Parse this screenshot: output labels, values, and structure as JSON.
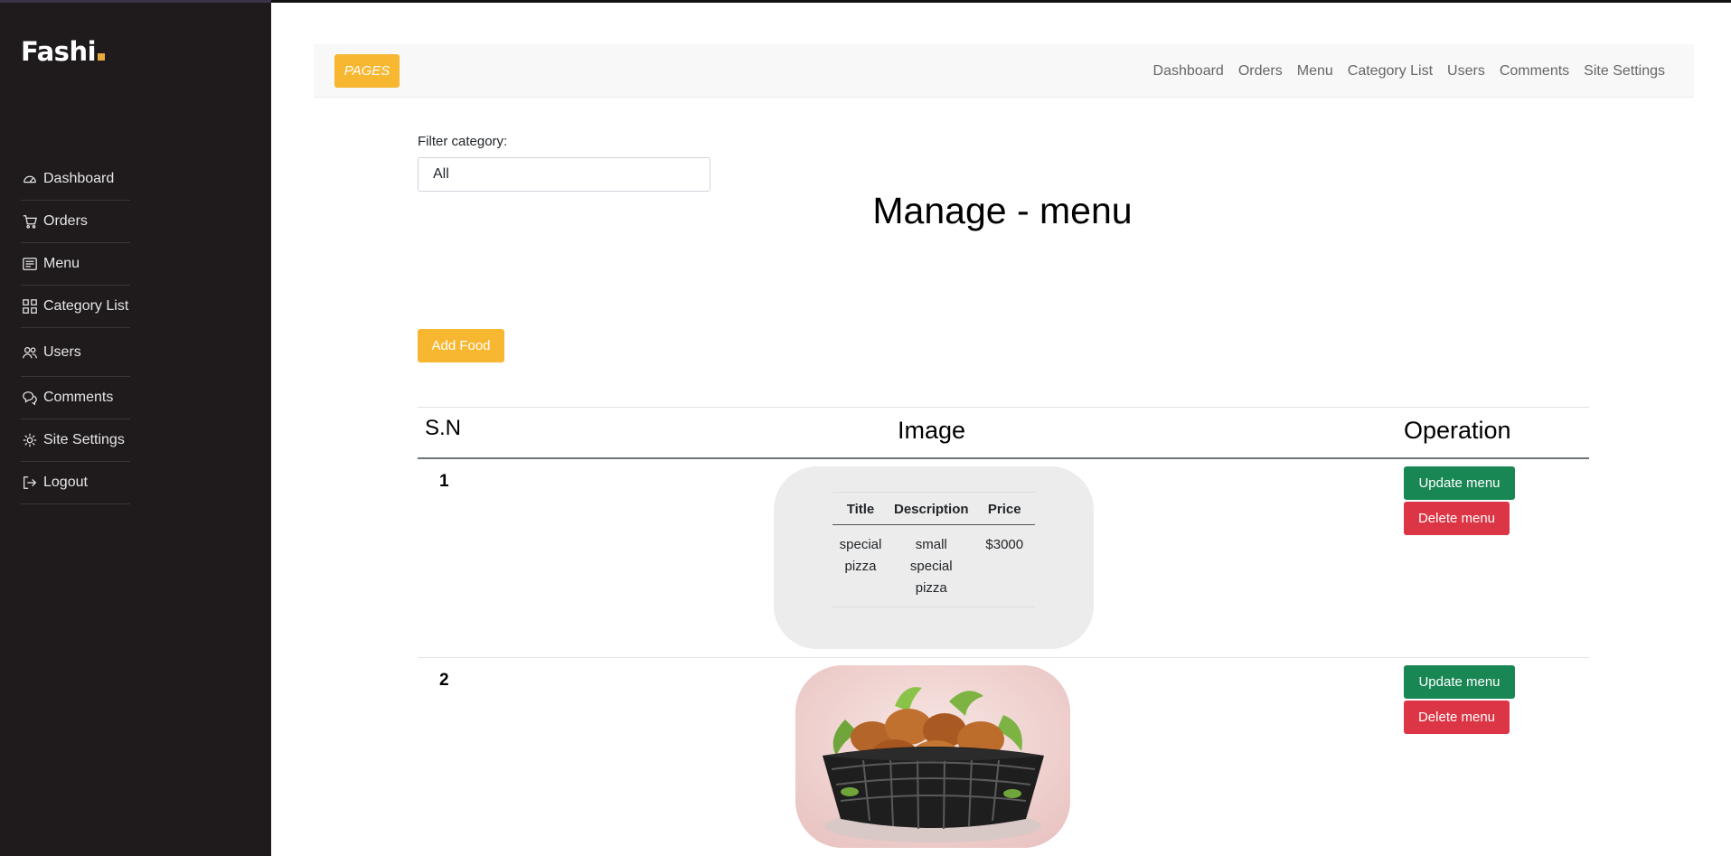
{
  "brand": {
    "name": "Fashi"
  },
  "sidebar": {
    "items": [
      {
        "label": "Dashboard",
        "icon": "speedometer-icon"
      },
      {
        "label": "Orders",
        "icon": "cart-icon"
      },
      {
        "label": "Menu",
        "icon": "menu-card-icon"
      },
      {
        "label": "Category List",
        "icon": "grid-icon"
      },
      {
        "label": "Users",
        "icon": "users-icon"
      },
      {
        "label": "Comments",
        "icon": "chat-icon"
      },
      {
        "label": "Site Settings",
        "icon": "gear-icon"
      },
      {
        "label": "Logout",
        "icon": "logout-icon"
      }
    ]
  },
  "topbar": {
    "pages_label": "PAGES",
    "links": [
      "Dashboard",
      "Orders",
      "Menu",
      "Category List",
      "Users",
      "Comments",
      "Site Settings"
    ]
  },
  "filter": {
    "label": "Filter category:",
    "selected": "All"
  },
  "page": {
    "title": "Manage - menu",
    "add_label": "Add Food"
  },
  "table": {
    "headers": {
      "sn": "S.N",
      "image": "Image",
      "operation": "Operation"
    },
    "rows": [
      {
        "sn": "1",
        "inner": {
          "headers": [
            "Title",
            "Description",
            "Price"
          ],
          "title": "special pizza",
          "description": "small special pizza",
          "price": "$3000"
        },
        "update_label": "Update menu",
        "delete_label": "Delete menu"
      },
      {
        "sn": "2",
        "image": "fried-chicken-basket-photo",
        "update_label": "Update menu",
        "delete_label": "Delete menu"
      }
    ]
  },
  "colors": {
    "accent": "#f7b731",
    "sidebar": "#1f1a1c",
    "update": "#198754",
    "delete": "#dc3545"
  }
}
